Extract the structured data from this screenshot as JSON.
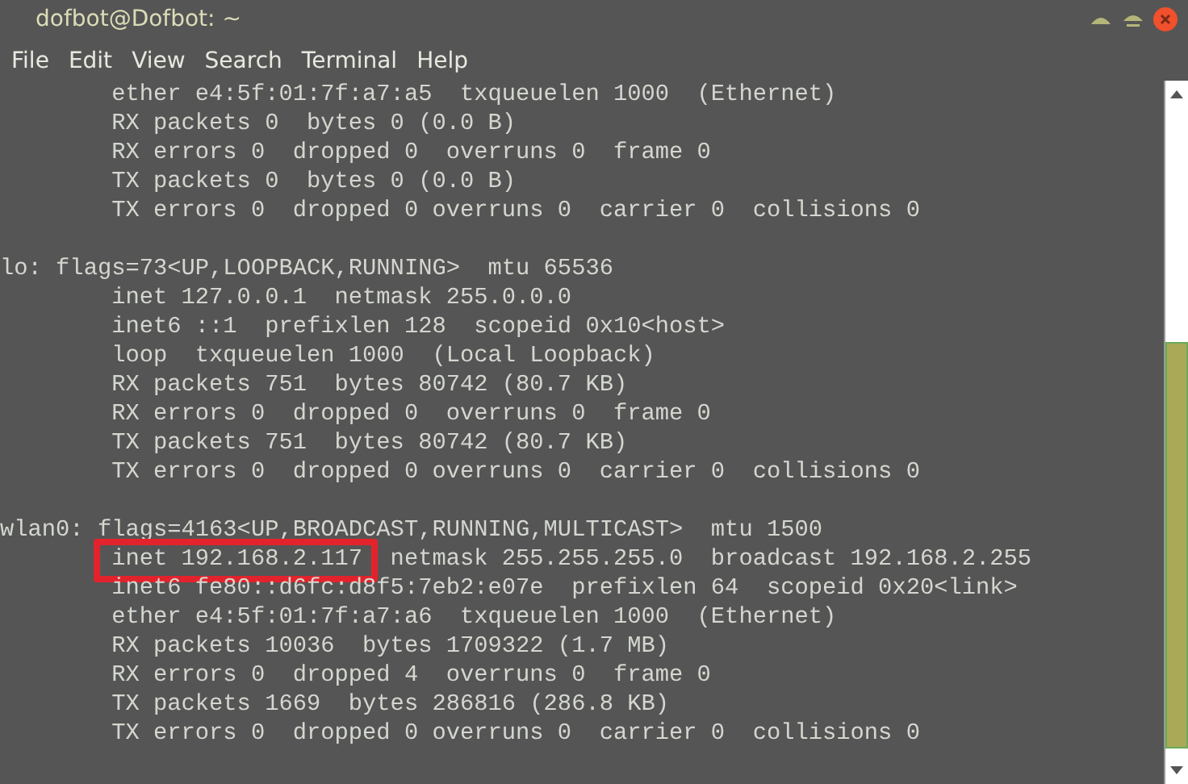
{
  "window": {
    "title": "dofbot@Dofbot: ~"
  },
  "menu": [
    {
      "label": "File"
    },
    {
      "label": "Edit"
    },
    {
      "label": "View"
    },
    {
      "label": "Search"
    },
    {
      "label": "Terminal"
    },
    {
      "label": "Help"
    }
  ],
  "terminal": {
    "blocks": [
      {
        "lines": [
          {
            "text": "        ether e4:5f:01:7f:a7:a5  txqueuelen 1000  (Ethernet)",
            "highlighted": false
          },
          {
            "text": "        RX packets 0  bytes 0 (0.0 B)",
            "highlighted": false
          },
          {
            "text": "        RX errors 0  dropped 0  overruns 0  frame 0",
            "highlighted": false
          },
          {
            "text": "        TX packets 0  bytes 0 (0.0 B)",
            "highlighted": false
          },
          {
            "text": "        TX errors 0  dropped 0 overruns 0  carrier 0  collisions 0",
            "highlighted": false
          }
        ]
      },
      {
        "lines": [
          {
            "text": "lo: flags=73<UP,LOOPBACK,RUNNING>  mtu 65536",
            "highlighted": false
          },
          {
            "text": "        inet 127.0.0.1  netmask 255.0.0.0",
            "highlighted": false
          },
          {
            "text": "        inet6 ::1  prefixlen 128  scopeid 0x10<host>",
            "highlighted": false
          },
          {
            "text": "        loop  txqueuelen 1000  (Local Loopback)",
            "highlighted": false
          },
          {
            "text": "        RX packets 751  bytes 80742 (80.7 KB)",
            "highlighted": false
          },
          {
            "text": "        RX errors 0  dropped 0  overruns 0  frame 0",
            "highlighted": false
          },
          {
            "text": "        TX packets 751  bytes 80742 (80.7 KB)",
            "highlighted": false
          },
          {
            "text": "        TX errors 0  dropped 0 overruns 0  carrier 0  collisions 0",
            "highlighted": false
          }
        ]
      },
      {
        "lines": [
          {
            "text": "wlan0: flags=4163<UP,BROADCAST,RUNNING,MULTICAST>  mtu 1500",
            "highlighted": false
          },
          {
            "text": "        inet 192.168.2.117  netmask 255.255.255.0  broadcast 192.168.2.255",
            "highlighted": true
          },
          {
            "text": "        inet6 fe80::d6fc:d8f5:7eb2:e07e  prefixlen 64  scopeid 0x20<link>",
            "highlighted": false
          },
          {
            "text": "        ether e4:5f:01:7f:a7:a6  txqueuelen 1000  (Ethernet)",
            "highlighted": false
          },
          {
            "text": "        RX packets 10036  bytes 1709322 (1.7 MB)",
            "highlighted": false
          },
          {
            "text": "        RX errors 0  dropped 4  overruns 0  frame 0",
            "highlighted": false
          },
          {
            "text": "        TX packets 1669  bytes 286816 (286.8 KB)",
            "highlighted": false
          },
          {
            "text": "        TX errors 0  dropped 0 overruns 0  carrier 0  collisions 0",
            "highlighted": false
          }
        ]
      }
    ]
  }
}
